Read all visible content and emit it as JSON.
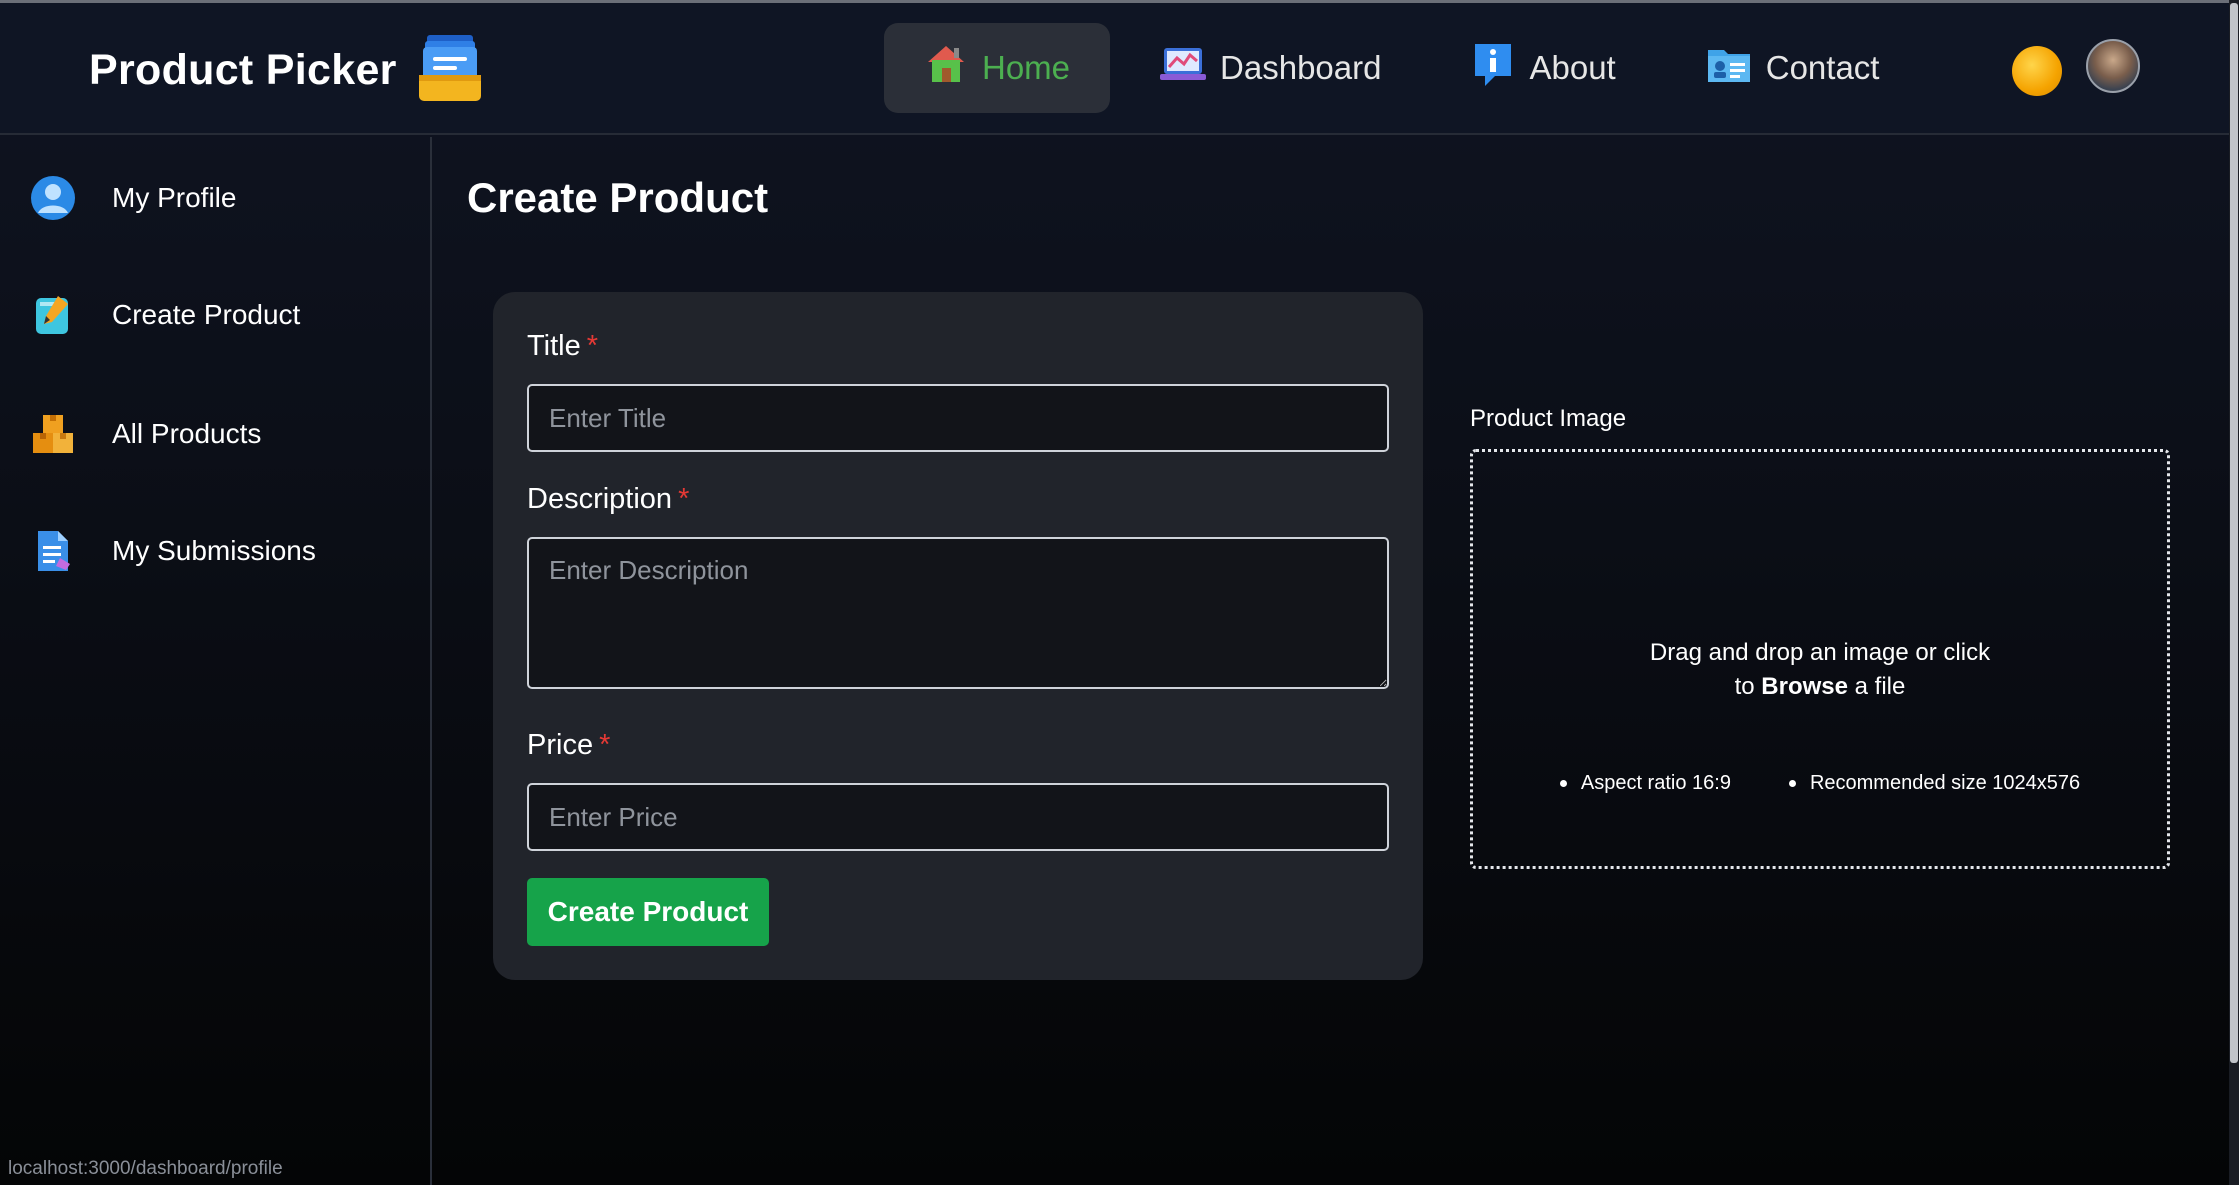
{
  "app": {
    "title": "Product Picker",
    "logo_icon": "document-tray-icon"
  },
  "nav": {
    "items": [
      {
        "label": "Home",
        "icon": "house-icon",
        "active": true
      },
      {
        "label": "Dashboard",
        "icon": "chart-laptop-icon"
      },
      {
        "label": "About",
        "icon": "info-bubble-icon"
      },
      {
        "label": "Contact",
        "icon": "contact-card-folder-icon"
      }
    ],
    "theme_icon": "sun-icon",
    "avatar": "user-avatar"
  },
  "sidebar": {
    "items": [
      {
        "label": "My Profile",
        "icon": "user-circle-icon"
      },
      {
        "label": "Create Product",
        "icon": "notepad-pencil-icon"
      },
      {
        "label": "All Products",
        "icon": "boxes-icon"
      },
      {
        "label": "My Submissions",
        "icon": "document-edit-icon"
      }
    ]
  },
  "page": {
    "title": "Create Product"
  },
  "form": {
    "title": {
      "label": "Title",
      "required_mark": "*",
      "placeholder": "Enter Title",
      "value": ""
    },
    "description": {
      "label": "Description",
      "required_mark": "*",
      "placeholder": "Enter Description",
      "value": ""
    },
    "price": {
      "label": "Price",
      "required_mark": "*",
      "placeholder": "Enter Price",
      "value": ""
    },
    "submit_label": "Create Product"
  },
  "image_upload": {
    "label": "Product Image",
    "drop_text_before": "Drag and drop an image or click to ",
    "browse_text": "Browse",
    "drop_text_after": " a file",
    "hints": [
      "Aspect ratio 16:9",
      "Recommended size 1024x576"
    ]
  },
  "status_bar": {
    "url": "localhost:3000/dashboard/profile"
  },
  "colors": {
    "accent_green": "#16a34a",
    "active_nav_text": "#4caf50",
    "required_red": "#e53935"
  }
}
